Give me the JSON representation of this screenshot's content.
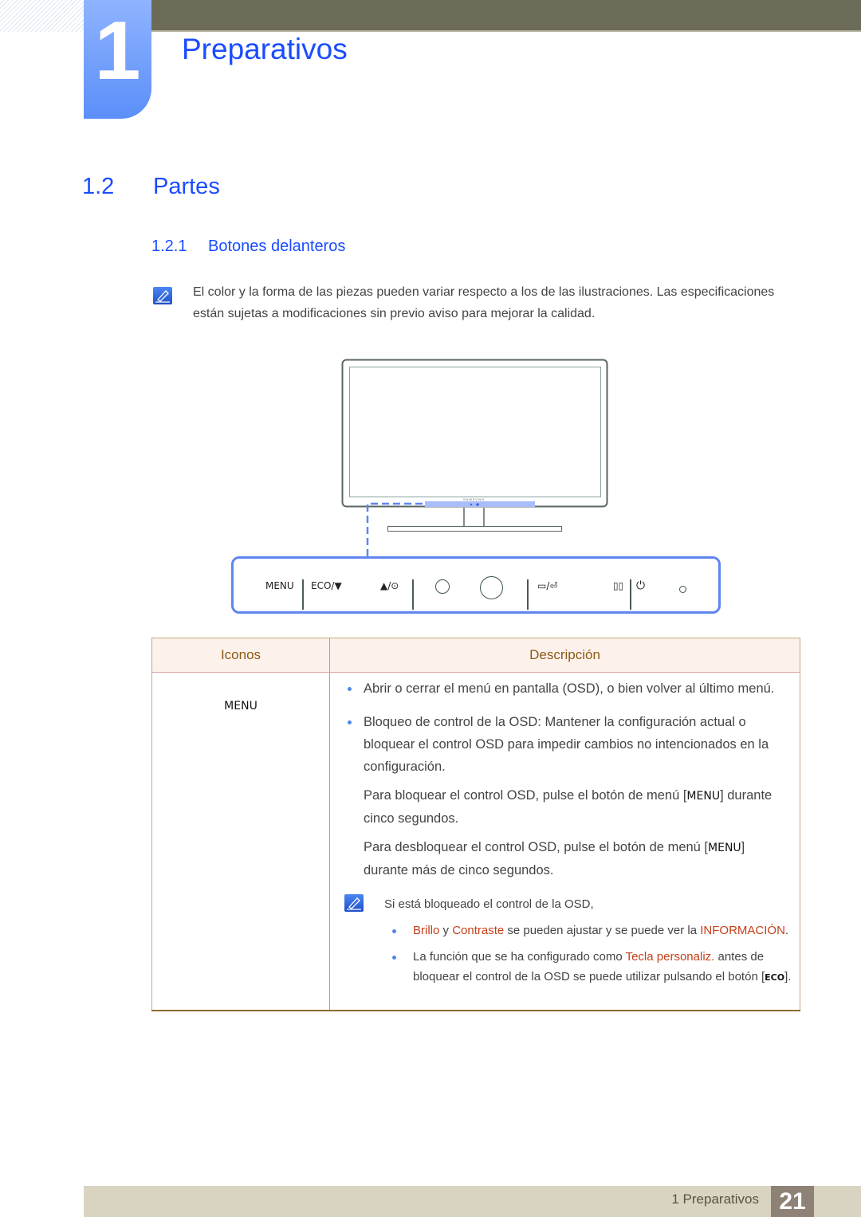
{
  "header": {
    "chapter_number": "1",
    "chapter_title": "Preparativos"
  },
  "section": {
    "number": "1.2",
    "title": "Partes"
  },
  "subsection": {
    "number": "1.2.1",
    "title": "Botones delanteros"
  },
  "note": {
    "icon": "note-pencil-icon",
    "text": "El color y la forma de las piezas pueden variar respecto a los de las ilustraciones. Las especificaciones están sujetas a modificaciones sin previo aviso para mejorar la calidad."
  },
  "illustration": {
    "brand": "SAMSUNG",
    "accent_color": "#5f86f0",
    "buttons": [
      {
        "label": "MENU"
      },
      {
        "label": "ECO/▼"
      },
      {
        "label": "▲/⊙"
      },
      {
        "icon": "small-circle-button-icon"
      },
      {
        "icon": "large-circle-button-icon"
      },
      {
        "label": "▭/⏎",
        "icon": "source-enter-icon"
      },
      {
        "label": "▯▯",
        "icon": "pip-icon"
      },
      {
        "icon": "power-icon",
        "label": "⏻"
      },
      {
        "icon": "power-led-icon"
      }
    ]
  },
  "table": {
    "headers": {
      "icons": "Iconos",
      "description": "Descripción"
    },
    "rows": [
      {
        "icon_label": "MENU",
        "bullets": [
          "Abrir o cerrar el menú en pantalla (OSD), o bien volver al último menú.",
          "Bloqueo de control de la OSD: Mantener la configuración actual o bloquear el control OSD para impedir cambios no intencionados en la configuración."
        ],
        "paragraphs": [
          {
            "before": "Para bloquear el control OSD, pulse el botón de menú [",
            "key": "MENU",
            "after": "] durante cinco segundos."
          },
          {
            "before": "Para desbloquear el control OSD, pulse el botón de menú [",
            "key": "MENU",
            "after": "] durante más de cinco segundos."
          }
        ],
        "note": {
          "intro": "Si está bloqueado el control de la OSD,",
          "item1": {
            "hl1": "Brillo",
            "mid1": " y ",
            "hl2": "Contraste",
            "mid2": " se pueden ajustar y se puede ver la ",
            "hl3": "INFORMACIÓN",
            "end": "."
          },
          "item2": {
            "before": "La función que se ha configurado como ",
            "hl": "Tecla personaliz.",
            "after": " antes de bloquear el control de la OSD se puede utilizar pulsando el botón [",
            "key": "ECO",
            "end": "]."
          }
        }
      }
    ]
  },
  "footer": {
    "label": "1 Preparativos",
    "page": "21"
  }
}
